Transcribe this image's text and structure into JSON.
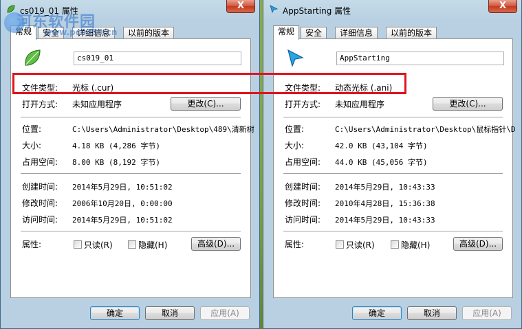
{
  "watermark": {
    "site": "河东软件园",
    "url": "www.pc0359.cn"
  },
  "icons": {
    "close": "close-x-icon",
    "leaf": "leaf-cursor-icon",
    "arrow": "arrow-cursor-icon"
  },
  "colors": {
    "highlight": "#e0141c",
    "accent": "#3c7fb1"
  },
  "windows": [
    {
      "title": "cs019_01 属性",
      "close": "X",
      "tabs": [
        "常规",
        "安全",
        "详细信息",
        "以前的版本"
      ],
      "name": "cs019_01",
      "type_label": "文件类型:",
      "type_value": "光标 (.cur)",
      "open_label": "打开方式:",
      "open_value": "未知应用程序",
      "change_btn": "更改(C)...",
      "loc_label": "位置:",
      "loc_value": "C:\\Users\\Administrator\\Desktop\\489\\清新树",
      "size_label": "大小:",
      "size_value": "4.18 KB (4,286 字节)",
      "disk_label": "占用空间:",
      "disk_value": "8.00 KB (8,192 字节)",
      "created_label": "创建时间:",
      "created_value": "2014年5月29日, 10:51:02",
      "modified_label": "修改时间:",
      "modified_value": "2006年10月20日, 0:00:00",
      "accessed_label": "访问时间:",
      "accessed_value": "2014年5月29日, 10:51:02",
      "attr_label": "属性:",
      "readonly": "只读(R)",
      "hidden": "隐藏(H)",
      "advanced_btn": "高级(D)...",
      "ok": "确定",
      "cancel": "取消",
      "apply": "应用(A)"
    },
    {
      "title": "AppStarting 属性",
      "close": "X",
      "tabs": [
        "常规",
        "安全",
        "详细信息",
        "以前的版本"
      ],
      "name": "AppStarting",
      "type_label": "文件类型:",
      "type_value": "动态光标 (.ani)",
      "open_label": "打开方式:",
      "open_value": "未知应用程序",
      "change_btn": "更改(C)...",
      "loc_label": "位置:",
      "loc_value": "C:\\Users\\Administrator\\Desktop\\鼠标指针\\D",
      "size_label": "大小:",
      "size_value": "42.0 KB (43,104 字节)",
      "disk_label": "占用空间:",
      "disk_value": "44.0 KB (45,056 字节)",
      "created_label": "创建时间:",
      "created_value": "2014年5月29日, 10:43:33",
      "modified_label": "修改时间:",
      "modified_value": "2010年4月28日, 15:36:38",
      "accessed_label": "访问时间:",
      "accessed_value": "2014年5月29日, 10:43:33",
      "attr_label": "属性:",
      "readonly": "只读(R)",
      "hidden": "隐藏(H)",
      "advanced_btn": "高级(D)...",
      "ok": "确定",
      "cancel": "取消",
      "apply": "应用(A)"
    }
  ]
}
